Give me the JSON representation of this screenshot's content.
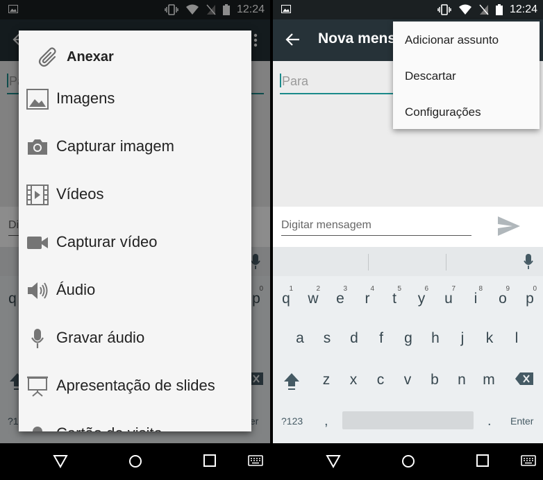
{
  "status_bar": {
    "time": "12:24"
  },
  "left": {
    "compose": {
      "to_placeholder": "Pa",
      "message_placeholder": "Di"
    },
    "attach_dialog": {
      "title": "Anexar",
      "items": [
        {
          "label": "Imagens",
          "icon": "image-icon"
        },
        {
          "label": "Capturar imagem",
          "icon": "camera-icon"
        },
        {
          "label": "Vídeos",
          "icon": "video-file-icon"
        },
        {
          "label": "Capturar vídeo",
          "icon": "videocam-icon"
        },
        {
          "label": "Áudio",
          "icon": "speaker-icon"
        },
        {
          "label": "Gravar áudio",
          "icon": "mic-icon"
        },
        {
          "label": "Apresentação de slides",
          "icon": "slideshow-icon"
        },
        {
          "label": "Cartão de visita",
          "icon": "contact-card-icon"
        }
      ]
    },
    "keyboard_fragments": {
      "q": "q",
      "p": "p",
      "zero": "0",
      "numbers": "?1",
      "enter": "ter"
    }
  },
  "right": {
    "toolbar": {
      "title": "Nova mensagem"
    },
    "overflow_menu": [
      "Adicionar assunto",
      "Descartar",
      "Configurações"
    ],
    "compose": {
      "to_placeholder": "Para",
      "message_placeholder": "Digitar mensagem"
    },
    "keyboard": {
      "row1": [
        {
          "key": "q",
          "hint": "1"
        },
        {
          "key": "w",
          "hint": "2"
        },
        {
          "key": "e",
          "hint": "3"
        },
        {
          "key": "r",
          "hint": "4"
        },
        {
          "key": "t",
          "hint": "5"
        },
        {
          "key": "y",
          "hint": "6"
        },
        {
          "key": "u",
          "hint": "7"
        },
        {
          "key": "i",
          "hint": "8"
        },
        {
          "key": "o",
          "hint": "9"
        },
        {
          "key": "p",
          "hint": "0"
        }
      ],
      "row2": [
        "a",
        "s",
        "d",
        "f",
        "g",
        "h",
        "j",
        "k",
        "l"
      ],
      "row3": [
        "z",
        "x",
        "c",
        "v",
        "b",
        "n",
        "m"
      ],
      "numbers_key": "?123",
      "comma_key": ",",
      "period_key": ".",
      "enter_key": "Enter"
    }
  },
  "colors": {
    "toolbar": "#263238",
    "status_bar": "#1b2022",
    "accent": "#1a8a8a",
    "keyboard": "#eceff1"
  }
}
